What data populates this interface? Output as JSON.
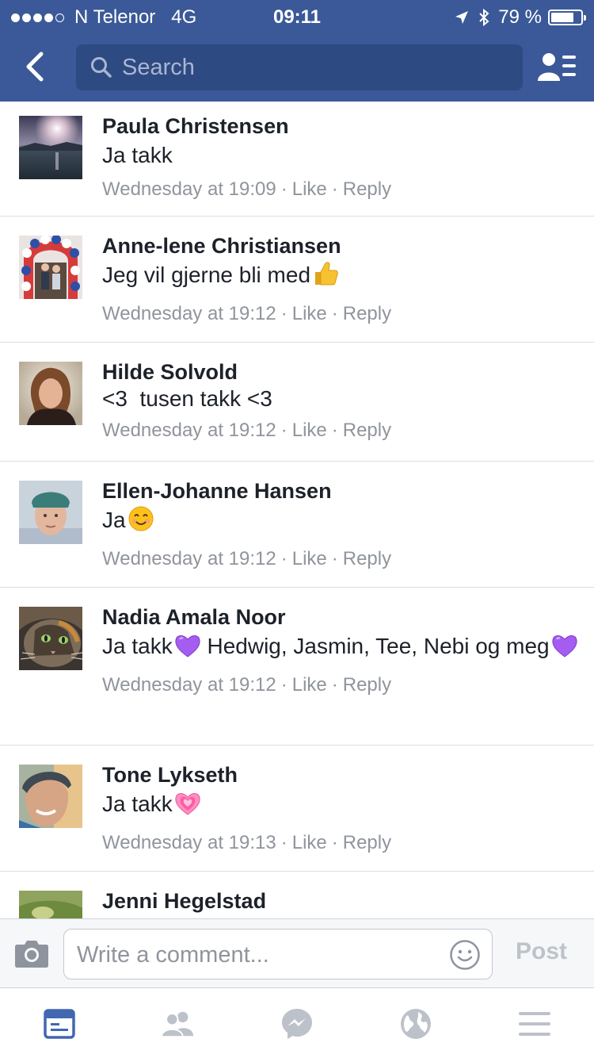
{
  "status_bar": {
    "carrier": "N Telenor",
    "network": "4G",
    "time": "09:11",
    "battery_percent": "79 %",
    "battery_level": 0.79,
    "signal_bars": 4
  },
  "search": {
    "placeholder": "Search"
  },
  "comments": [
    {
      "name": "Paula Christensen",
      "text": "Ja takk",
      "emoji": "",
      "text2": "",
      "emoji2": "",
      "time": "Wednesday at 19:09",
      "like": "Like",
      "reply": "Reply"
    },
    {
      "name": "Anne-lene Christiansen",
      "text": "Jeg vil gjerne bli med",
      "emoji": "thumbs-up",
      "time": "Wednesday at 19:12",
      "like": "Like",
      "reply": "Reply"
    },
    {
      "name": "Hilde Solvold",
      "text": "<3  tusen takk <3",
      "emoji": "",
      "time": "Wednesday at 19:12",
      "like": "Like",
      "reply": "Reply"
    },
    {
      "name": "Ellen-Johanne Hansen",
      "text": "Ja",
      "emoji": "smiling-face",
      "time": "Wednesday at 19:12",
      "like": "Like",
      "reply": "Reply"
    },
    {
      "name": "Nadia Amala Noor",
      "text": "Ja takk",
      "emoji": "purple-heart",
      "text2": " Hedwig, Jasmin, Tee, Nebi og meg",
      "emoji2": "purple-heart",
      "time": "Wednesday at 19:12",
      "like": "Like",
      "reply": "Reply"
    },
    {
      "name": "Tone Lykseth",
      "text": "Ja takk",
      "emoji": "growing-heart",
      "time": "Wednesday at 19:13",
      "like": "Like",
      "reply": "Reply"
    },
    {
      "name": "Jenni Hegelstad"
    }
  ],
  "composer": {
    "placeholder": "Write a comment...",
    "post_label": "Post"
  },
  "tabbar": {
    "items": [
      "news-feed-icon",
      "friends-icon",
      "messenger-icon",
      "globe-icon",
      "menu-icon"
    ],
    "active": "news-feed-icon",
    "active_color": "#4267b2",
    "inactive_color": "#bdc1c9"
  },
  "colors": {
    "header": "#3b5998",
    "search_bg": "#2e4a82",
    "name_text": "#1d2129",
    "meta_text": "#90949c"
  }
}
